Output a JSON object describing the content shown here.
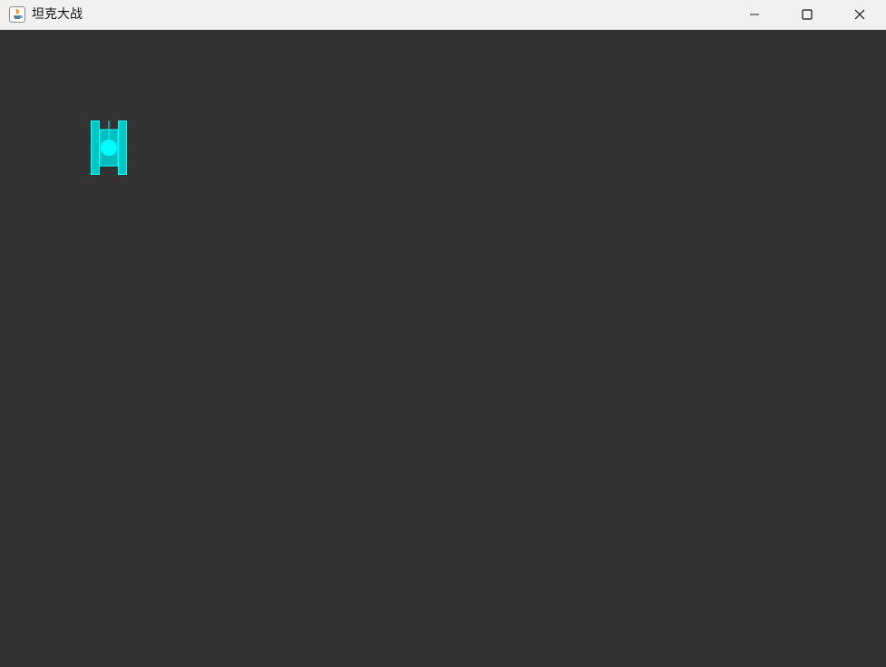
{
  "window": {
    "title": "坦克大战",
    "icon": "java-app-icon",
    "controls": {
      "minimize_icon": "minimize-icon",
      "maximize_icon": "maximize-icon",
      "close_icon": "close-icon"
    }
  },
  "game": {
    "background_color": "#333333",
    "player_tank": {
      "color": "#00cccc",
      "turret_color": "#00ffff",
      "direction": "up"
    }
  }
}
